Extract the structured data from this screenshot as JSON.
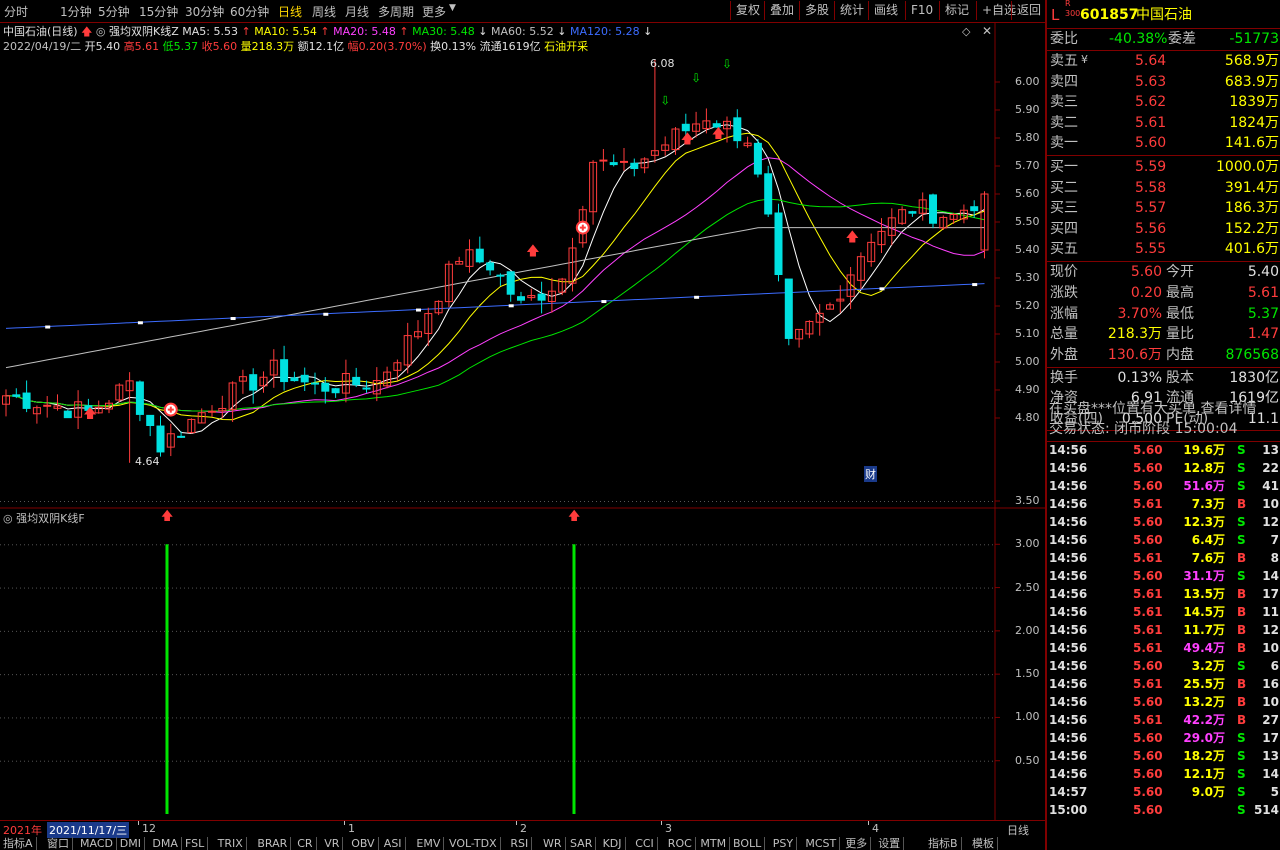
{
  "toolbar": {
    "periods": [
      "分时",
      "1分钟",
      "5分钟",
      "15分钟",
      "30分钟",
      "60分钟",
      "日线",
      "周线",
      "月线",
      "多周期",
      "更多"
    ],
    "active_period": "日线",
    "buttons": [
      "复权",
      "叠加",
      "多股",
      "统计",
      "画线",
      "F10",
      "标记",
      "+自选",
      "返回"
    ]
  },
  "info": {
    "stock_name": "中国石油(日线)",
    "indicator_name": "强均双阴K线Z",
    "ma5": "MA5: 5.53",
    "ma10": "MA10: 5.54",
    "ma20": "MA20: 5.48",
    "ma30": "MA30: 5.48",
    "ma60": "MA60: 5.52",
    "ma120": "MA120: 5.28",
    "date": "2022/04/19/二",
    "open": "开5.40",
    "high": "高5.61",
    "low": "低5.37",
    "close": "收5.60",
    "volume": "量218.3万",
    "amount": "额12.1亿",
    "change": "幅0.20(3.70%)",
    "turnover": "换0.13%",
    "float": "流通1619亿",
    "concept": "石油开采"
  },
  "chart_main": {
    "price_ticks": [
      "6.00",
      "5.90",
      "5.80",
      "5.70",
      "5.60",
      "5.50",
      "5.40",
      "5.30",
      "5.20",
      "5.10",
      "5.00",
      "4.90",
      "4.80"
    ],
    "high_marker": "6.08",
    "low_marker": "4.64",
    "cai_label": "财"
  },
  "chart_sub": {
    "title": "强均双阴K线F",
    "ticks": [
      "3.50",
      "3.00",
      "2.50",
      "2.00",
      "1.50",
      "1.00",
      "0.50"
    ]
  },
  "chart_data": [
    {
      "type": "candlestick",
      "title": "中国石油(日线)",
      "ylim": [
        4.64,
        6.08
      ],
      "last_bar": {
        "date": "2022/04/19",
        "open": 5.4,
        "high": 5.61,
        "low": 5.37,
        "close": 5.6
      },
      "moving_averages": [
        {
          "name": "MA5",
          "value": 5.53,
          "color": "#ffffff"
        },
        {
          "name": "MA10",
          "value": 5.54,
          "color": "#ffff00"
        },
        {
          "name": "MA20",
          "value": 5.48,
          "color": "#ff40ff"
        },
        {
          "name": "MA30",
          "value": 5.48,
          "color": "#00e600"
        },
        {
          "name": "MA60",
          "value": 5.52,
          "color": "#c0c0c0"
        },
        {
          "name": "MA120",
          "value": 5.28,
          "color": "#3c6cff"
        }
      ]
    },
    {
      "type": "bar",
      "title": "强均双阴K线F",
      "ylim": [
        0,
        3.5
      ],
      "values": [
        3,
        3
      ]
    }
  ],
  "x_axis": {
    "labels": [
      "2021年",
      "2021/11/17/三",
      "12",
      "1",
      "2",
      "3",
      "4"
    ],
    "right_label": "日线"
  },
  "tabs": [
    "指标A",
    "窗口",
    "MACD",
    "DMI",
    "DMA",
    "FSL",
    "TRIX",
    "BRAR",
    "CR",
    "VR",
    "OBV",
    "ASI",
    "EMV",
    "VOL-TDX",
    "RSI",
    "WR",
    "SAR",
    "KDJ",
    "CCI",
    "ROC",
    "MTM",
    "BOLL",
    "PSY",
    "MCST",
    "更多",
    "设置",
    "指标B",
    "模板"
  ],
  "quote": {
    "code": "601857",
    "name": "中国石油",
    "market_flag": "L",
    "weibi_label": "委比",
    "weibi": "-40.38%",
    "weicha_label": "委差",
    "weicha": "-51773",
    "sell": [
      {
        "label": "卖五",
        "price": "5.64",
        "vol": "568.9万"
      },
      {
        "label": "卖四",
        "price": "5.63",
        "vol": "683.9万"
      },
      {
        "label": "卖三",
        "price": "5.62",
        "vol": "1839万"
      },
      {
        "label": "卖二",
        "price": "5.61",
        "vol": "1824万"
      },
      {
        "label": "卖一",
        "price": "5.60",
        "vol": "141.6万"
      }
    ],
    "buy": [
      {
        "label": "买一",
        "price": "5.59",
        "vol": "1000.0万"
      },
      {
        "label": "买二",
        "price": "5.58",
        "vol": "391.4万"
      },
      {
        "label": "买三",
        "price": "5.57",
        "vol": "186.3万"
      },
      {
        "label": "买四",
        "price": "5.56",
        "vol": "152.2万"
      },
      {
        "label": "买五",
        "price": "5.55",
        "vol": "401.6万"
      }
    ],
    "stats": [
      {
        "l1": "现价",
        "v1": "5.60",
        "l2": "今开",
        "v2": "5.40",
        "c1": "#ff3c3c",
        "c2": "#e0e0e0"
      },
      {
        "l1": "涨跌",
        "v1": "0.20",
        "l2": "最高",
        "v2": "5.61",
        "c1": "#ff3c3c",
        "c2": "#ff3c3c"
      },
      {
        "l1": "涨幅",
        "v1": "3.70%",
        "l2": "最低",
        "v2": "5.37",
        "c1": "#ff3c3c",
        "c2": "#00e600"
      },
      {
        "l1": "总量",
        "v1": "218.3万",
        "l2": "量比",
        "v2": "1.47",
        "c1": "#ffff00",
        "c2": "#ff3c3c"
      },
      {
        "l1": "外盘",
        "v1": "130.6万",
        "l2": "内盘",
        "v2": "876568",
        "c1": "#ff3c3c",
        "c2": "#00e600"
      }
    ],
    "fund": [
      {
        "l1": "换手",
        "v1": "0.13%",
        "l2": "股本",
        "v2": "1830亿"
      },
      {
        "l1": "净资",
        "v1": "6.91",
        "l2": "流通",
        "v2": "1619亿"
      },
      {
        "l1": "收益(四)",
        "v1": "0.500",
        "l2": "PE(动)",
        "v2": "11.1"
      }
    ],
    "notice": "在买盘***位置有大买单,查看详情",
    "status": "交易状态: 闭市阶段 15:00:04"
  },
  "ticks": [
    {
      "t": "14:56",
      "p": "5.60",
      "v": "19.6万",
      "d": "S",
      "n": "13",
      "vc": "#ffff00"
    },
    {
      "t": "14:56",
      "p": "5.60",
      "v": "12.8万",
      "d": "S",
      "n": "22",
      "vc": "#ffff00"
    },
    {
      "t": "14:56",
      "p": "5.60",
      "v": "51.6万",
      "d": "S",
      "n": "41",
      "vc": "#ff40ff"
    },
    {
      "t": "14:56",
      "p": "5.61",
      "v": "7.3万",
      "d": "B",
      "n": "10",
      "vc": "#ffff00"
    },
    {
      "t": "14:56",
      "p": "5.60",
      "v": "12.3万",
      "d": "S",
      "n": "12",
      "vc": "#ffff00"
    },
    {
      "t": "14:56",
      "p": "5.60",
      "v": "6.4万",
      "d": "S",
      "n": "7",
      "vc": "#ffff00"
    },
    {
      "t": "14:56",
      "p": "5.61",
      "v": "7.6万",
      "d": "B",
      "n": "8",
      "vc": "#ffff00"
    },
    {
      "t": "14:56",
      "p": "5.60",
      "v": "31.1万",
      "d": "S",
      "n": "14",
      "vc": "#ff40ff"
    },
    {
      "t": "14:56",
      "p": "5.61",
      "v": "13.5万",
      "d": "B",
      "n": "17",
      "vc": "#ffff00"
    },
    {
      "t": "14:56",
      "p": "5.61",
      "v": "14.5万",
      "d": "B",
      "n": "11",
      "vc": "#ffff00"
    },
    {
      "t": "14:56",
      "p": "5.61",
      "v": "11.7万",
      "d": "B",
      "n": "12",
      "vc": "#ffff00"
    },
    {
      "t": "14:56",
      "p": "5.61",
      "v": "49.4万",
      "d": "B",
      "n": "10",
      "vc": "#ff40ff"
    },
    {
      "t": "14:56",
      "p": "5.60",
      "v": "3.2万",
      "d": "S",
      "n": "6",
      "vc": "#ffff00"
    },
    {
      "t": "14:56",
      "p": "5.61",
      "v": "25.5万",
      "d": "B",
      "n": "16",
      "vc": "#ffff00"
    },
    {
      "t": "14:56",
      "p": "5.60",
      "v": "13.2万",
      "d": "B",
      "n": "10",
      "vc": "#ffff00"
    },
    {
      "t": "14:56",
      "p": "5.61",
      "v": "42.2万",
      "d": "B",
      "n": "27",
      "vc": "#ff40ff"
    },
    {
      "t": "14:56",
      "p": "5.60",
      "v": "29.0万",
      "d": "S",
      "n": "17",
      "vc": "#ff40ff"
    },
    {
      "t": "14:56",
      "p": "5.60",
      "v": "18.2万",
      "d": "S",
      "n": "13",
      "vc": "#ffff00"
    },
    {
      "t": "14:56",
      "p": "5.60",
      "v": "12.1万",
      "d": "S",
      "n": "14",
      "vc": "#ffff00"
    },
    {
      "t": "14:57",
      "p": "5.60",
      "v": "9.0万",
      "d": "S",
      "n": "5",
      "vc": "#ffff00"
    },
    {
      "t": "15:00",
      "p": "5.60",
      "v": "",
      "d": "S",
      "n": "514",
      "vc": "#ffff00"
    }
  ],
  "colors": {
    "up": "#ff3c3c",
    "down": "#00e0e0",
    "frame": "#800000",
    "ma5": "#ffffff",
    "ma10": "#ffff00",
    "ma20": "#ff40ff",
    "ma30": "#00e600",
    "ma60": "#c0c0c0",
    "ma120": "#3c6cff"
  }
}
